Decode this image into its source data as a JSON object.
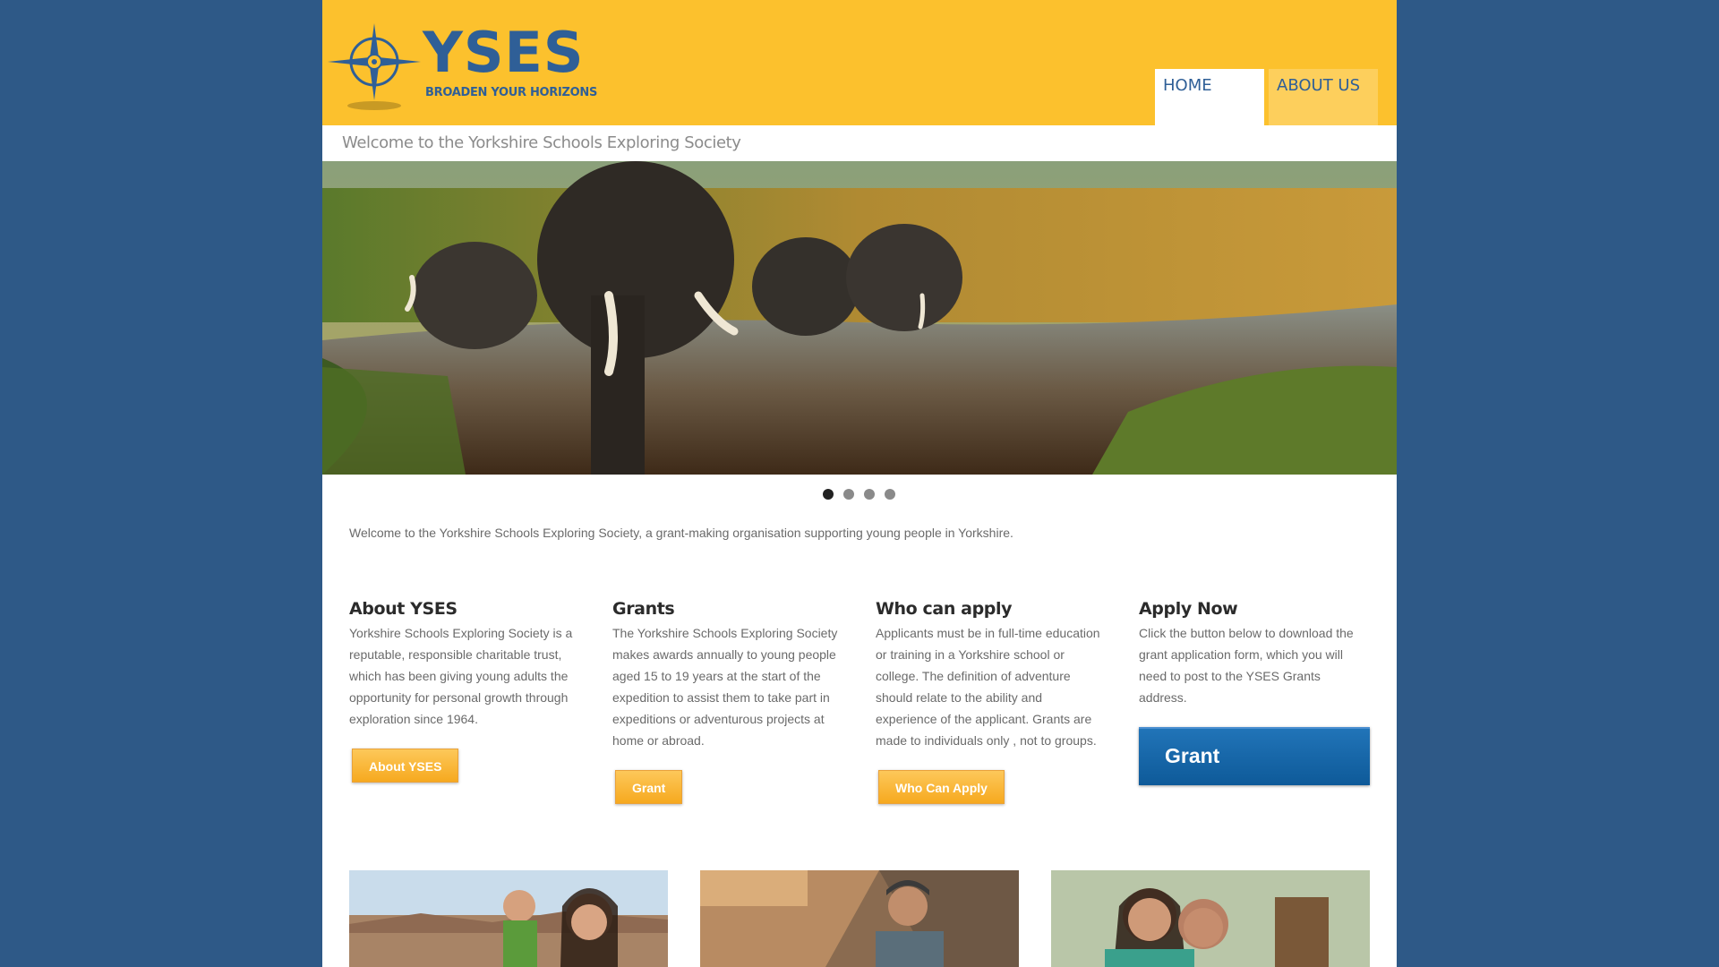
{
  "brand": {
    "name": "YSES",
    "tagline": "BROADEN YOUR HORIZONS",
    "colors": {
      "background": "#2e5987",
      "header": "#fcc12d",
      "primary": "#2f5f97",
      "button": "#f6a91f",
      "grant_button": "#0e5a99"
    }
  },
  "nav": {
    "items": [
      {
        "label": "HOME",
        "active": true
      },
      {
        "label": "ABOUT US",
        "active": false
      }
    ]
  },
  "strip": {
    "text": "Welcome to the Yorkshire Schools Exploring Society"
  },
  "slider": {
    "dot_count": 4,
    "active_index": 0
  },
  "intro": "Welcome to the Yorkshire Schools Exploring Society, a grant-making organisation supporting young people in Yorkshire.",
  "columns": [
    {
      "title": "About YSES",
      "lines": [
        "Yorkshire Schools Exploring Society is a",
        "reputable, responsible charitable trust,",
        "which has been giving young adults the",
        "opportunity for personal growth through",
        "exploration since 1964."
      ],
      "button": "About YSES"
    },
    {
      "title": "Grants",
      "lines": [
        "The Yorkshire Schools Exploring Society",
        "makes awards annually to young people",
        "aged 15 to 19 years  at the start of the",
        "expedition to assist them to take part in",
        "expeditions or adventurous projects at",
        "home or abroad."
      ],
      "button": "Grant"
    },
    {
      "title": "Who can apply",
      "lines": [
        "Applicants must be in full-time education",
        "or training in a Yorkshire school or",
        "college. The definition of adventure",
        "should relate to the ability and",
        "experience of the applicant. Grants are",
        "made to individuals only , not to groups."
      ],
      "button": "Who Can Apply"
    },
    {
      "title": "Apply Now",
      "lines": [
        "Click the button below to download the",
        "grant application form, which you will",
        "need to post to the YSES Grants",
        "address."
      ],
      "button": "Grant"
    }
  ]
}
